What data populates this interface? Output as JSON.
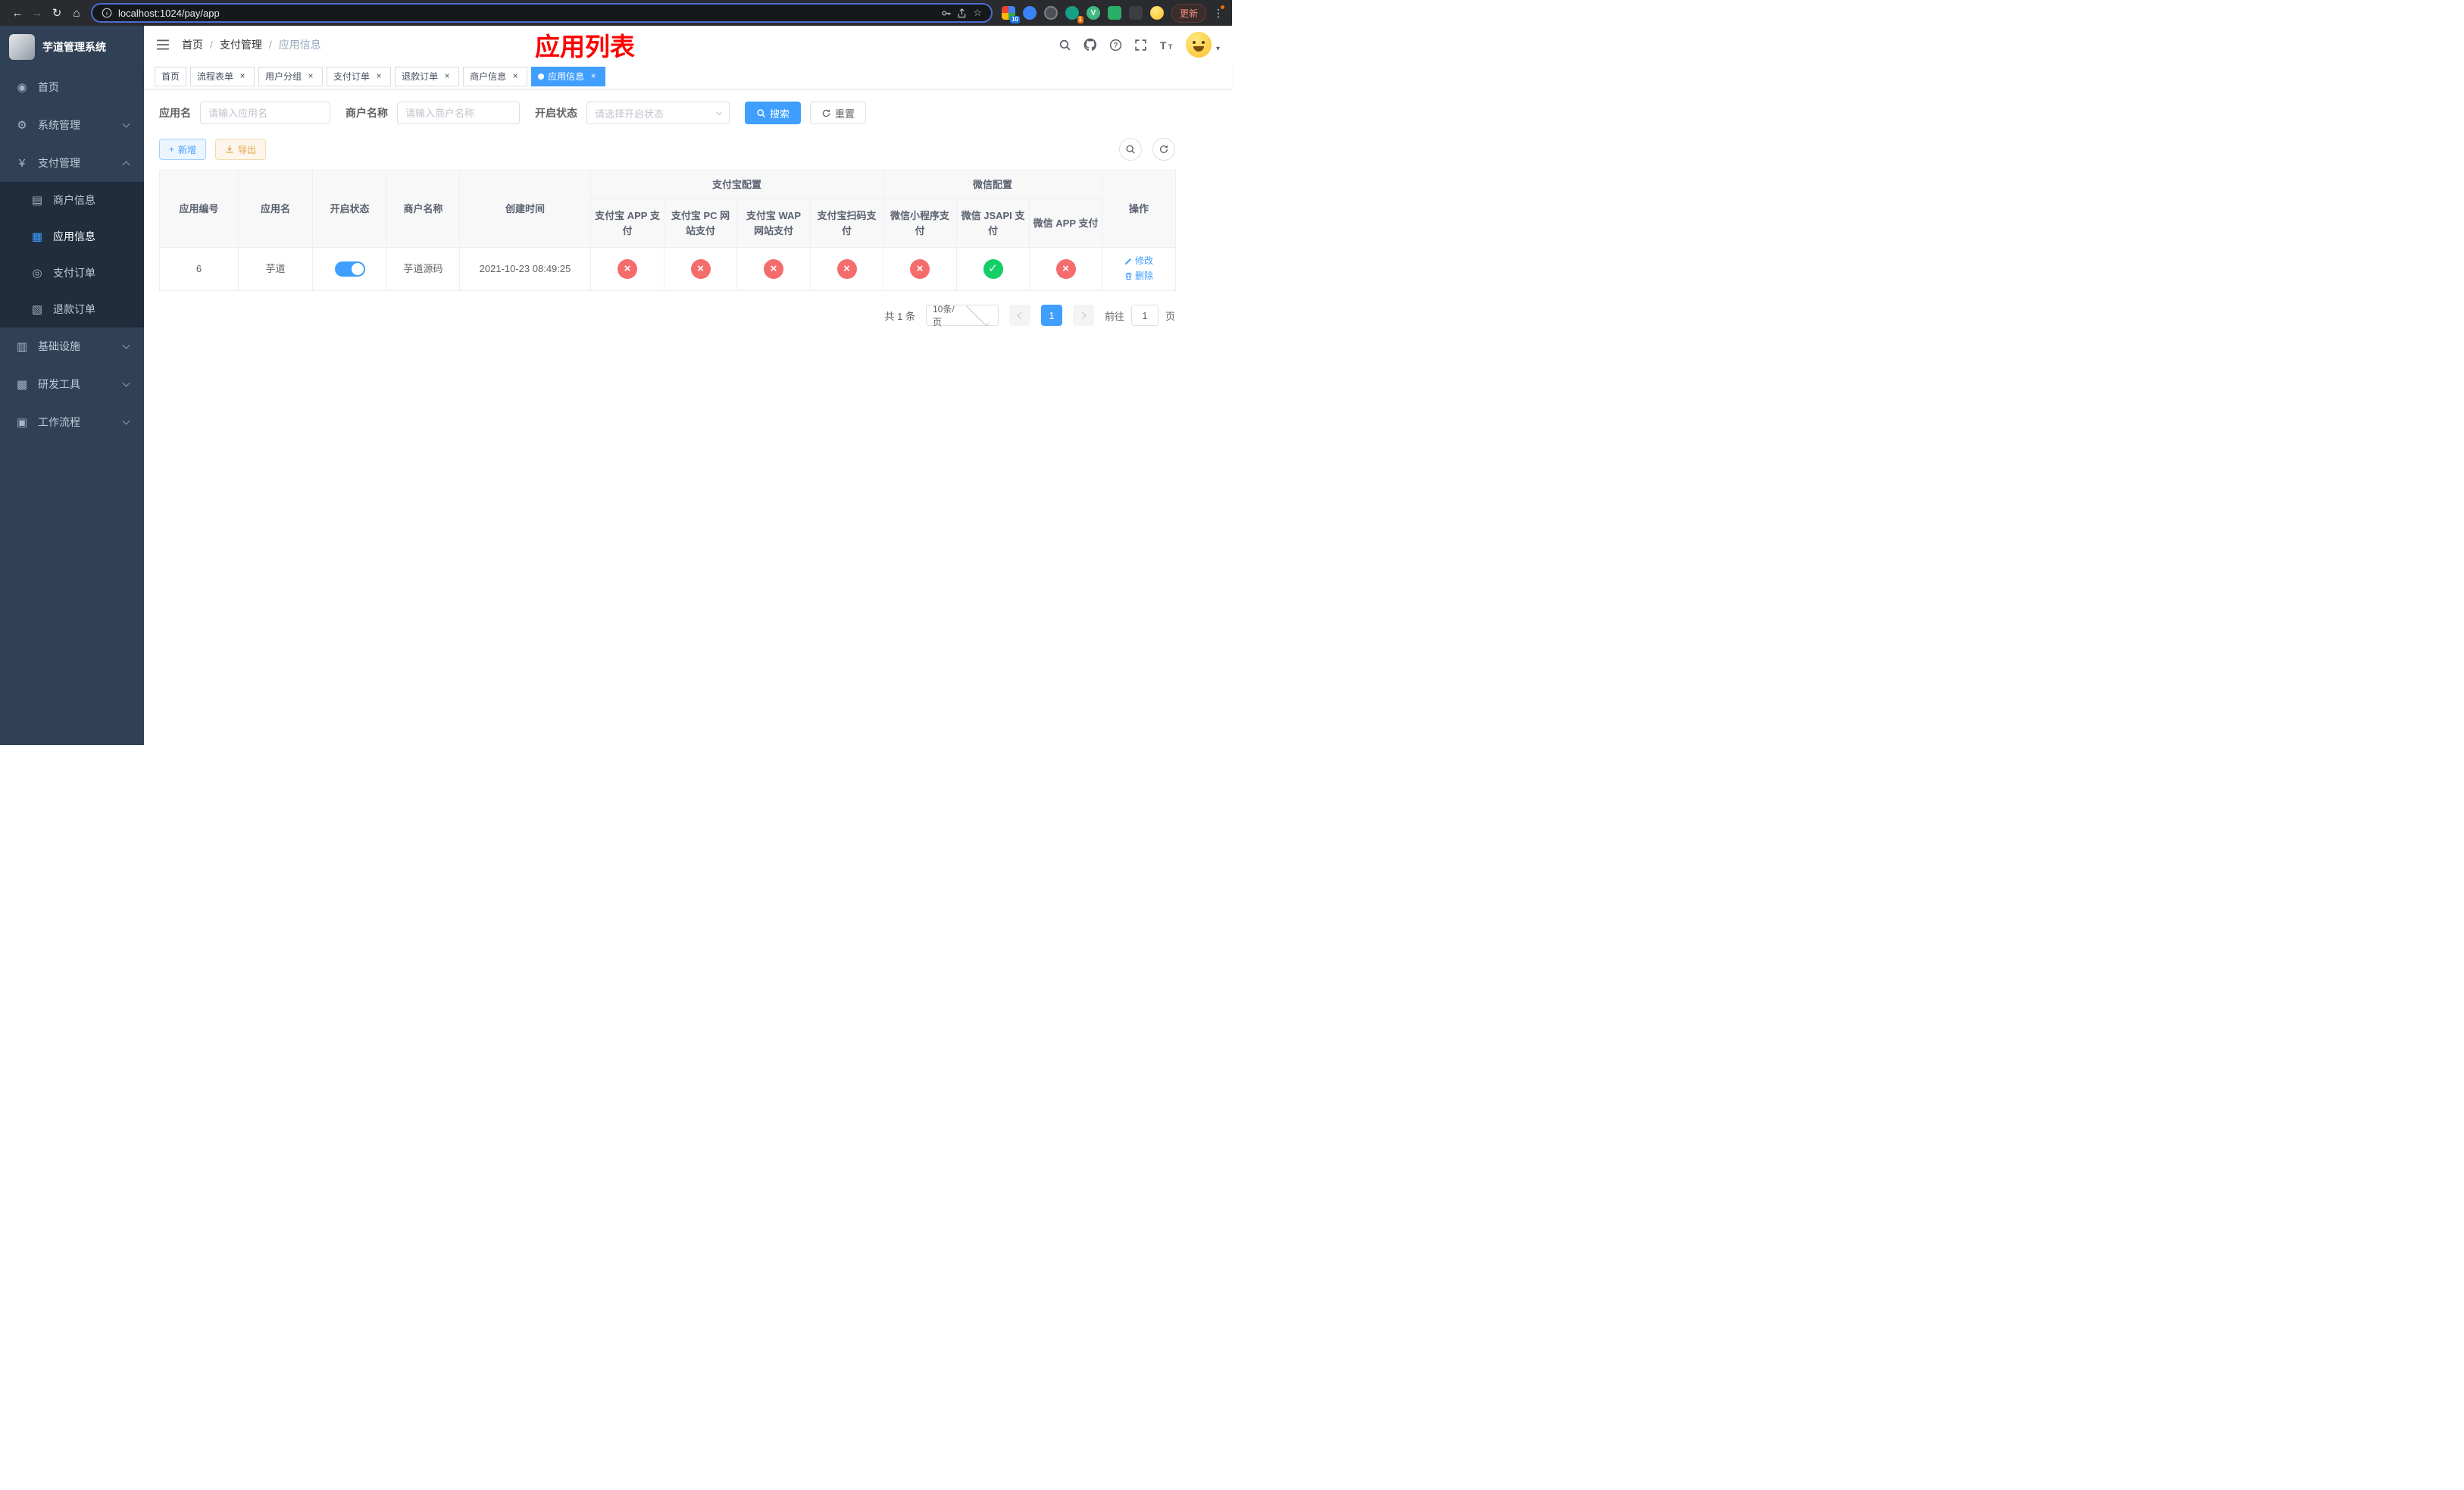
{
  "browser": {
    "url": "localhost:1024/pay/app",
    "update_label": "更新",
    "badge_extensions": "10",
    "badge_translate": "1"
  },
  "sidebar": {
    "logo_title": "芋道管理系统",
    "items": [
      {
        "label": "首页",
        "icon": "dashboard-icon"
      },
      {
        "label": "系统管理",
        "icon": "gear-icon",
        "chevron": true
      },
      {
        "label": "支付管理",
        "icon": "yen-icon",
        "chevron": true,
        "expanded": true,
        "children": [
          {
            "label": "商户信息",
            "icon": "merchant-icon"
          },
          {
            "label": "应用信息",
            "icon": "app-info-icon",
            "active": true
          },
          {
            "label": "支付订单",
            "icon": "pay-order-icon"
          },
          {
            "label": "退款订单",
            "icon": "refund-order-icon"
          }
        ]
      },
      {
        "label": "基础设施",
        "icon": "infra-icon",
        "chevron": true
      },
      {
        "label": "研发工具",
        "icon": "devtools-icon",
        "chevron": true
      },
      {
        "label": "工作流程",
        "icon": "workflow-icon",
        "chevron": true
      }
    ]
  },
  "header": {
    "breadcrumb": [
      "首页",
      "支付管理",
      "应用信息"
    ],
    "separator": "/",
    "annotation": "应用列表"
  },
  "tabs": [
    {
      "label": "首页",
      "closable": false
    },
    {
      "label": "流程表单",
      "closable": true
    },
    {
      "label": "用户分组",
      "closable": true
    },
    {
      "label": "支付订单",
      "closable": true
    },
    {
      "label": "退款订单",
      "closable": true
    },
    {
      "label": "商户信息",
      "closable": true
    },
    {
      "label": "应用信息",
      "closable": true,
      "active": true
    }
  ],
  "filters": {
    "app_name_label": "应用名",
    "app_name_placeholder": "请输入应用名",
    "merchant_label": "商户名称",
    "merchant_placeholder": "请输入商户名称",
    "status_label": "开启状态",
    "status_placeholder": "请选择开启状态",
    "search_label": "搜索",
    "reset_label": "重置"
  },
  "toolbar": {
    "add_label": "新增",
    "export_label": "导出"
  },
  "table": {
    "groups": {
      "alipay": "支付宝配置",
      "wechat": "微信配置"
    },
    "columns": [
      "应用编号",
      "应用名",
      "开启状态",
      "商户名称",
      "创建时间",
      "支付宝 APP 支付",
      "支付宝 PC 网站支付",
      "支付宝 WAP 网站支付",
      "支付宝扫码支付",
      "微信小程序支付",
      "微信 JSAPI 支付",
      "微信 APP 支付",
      "操作"
    ],
    "rows": [
      {
        "id": "6",
        "app_name": "芋道",
        "status_on": true,
        "merchant": "芋道源码",
        "created": "2021-10-23 08:49:25",
        "configs": [
          false,
          false,
          false,
          false,
          false,
          true,
          false
        ],
        "actions": {
          "edit": "修改",
          "delete": "删除"
        }
      }
    ]
  },
  "pagination": {
    "total": "共 1 条",
    "page_size": "10条/页",
    "page": "1",
    "goto_label": "前往",
    "goto_value": "1",
    "page_unit": "页"
  },
  "colors": {
    "accent": "#409eff",
    "success": "#13ce66",
    "danger": "#f56c6c",
    "warning": "#e6a23c",
    "sidebar": "#304156",
    "annotation": "#ff0000"
  }
}
